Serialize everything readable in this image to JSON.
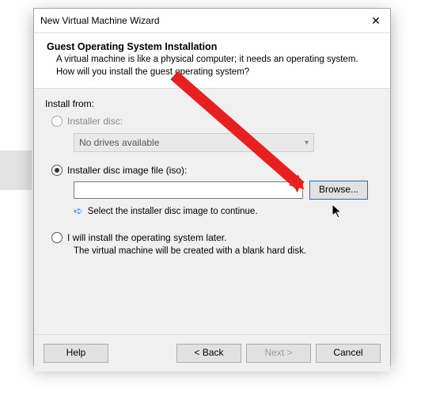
{
  "window": {
    "title": "New Virtual Machine Wizard"
  },
  "header": {
    "title": "Guest Operating System Installation",
    "description": "A virtual machine is like a physical computer; it needs an operating system. How will you install the guest operating system?"
  },
  "body": {
    "install_from_label": "Install from:",
    "option_disc": {
      "label": "Installer disc:",
      "drives_text": "No drives available"
    },
    "option_iso": {
      "label": "Installer disc image file (iso):",
      "browse_label": "Browse...",
      "hint": "Select the installer disc image to continue."
    },
    "option_later": {
      "label": "I will install the operating system later.",
      "desc": "The virtual machine will be created with a blank hard disk."
    }
  },
  "footer": {
    "help": "Help",
    "back": "< Back",
    "next": "Next >",
    "cancel": "Cancel"
  }
}
